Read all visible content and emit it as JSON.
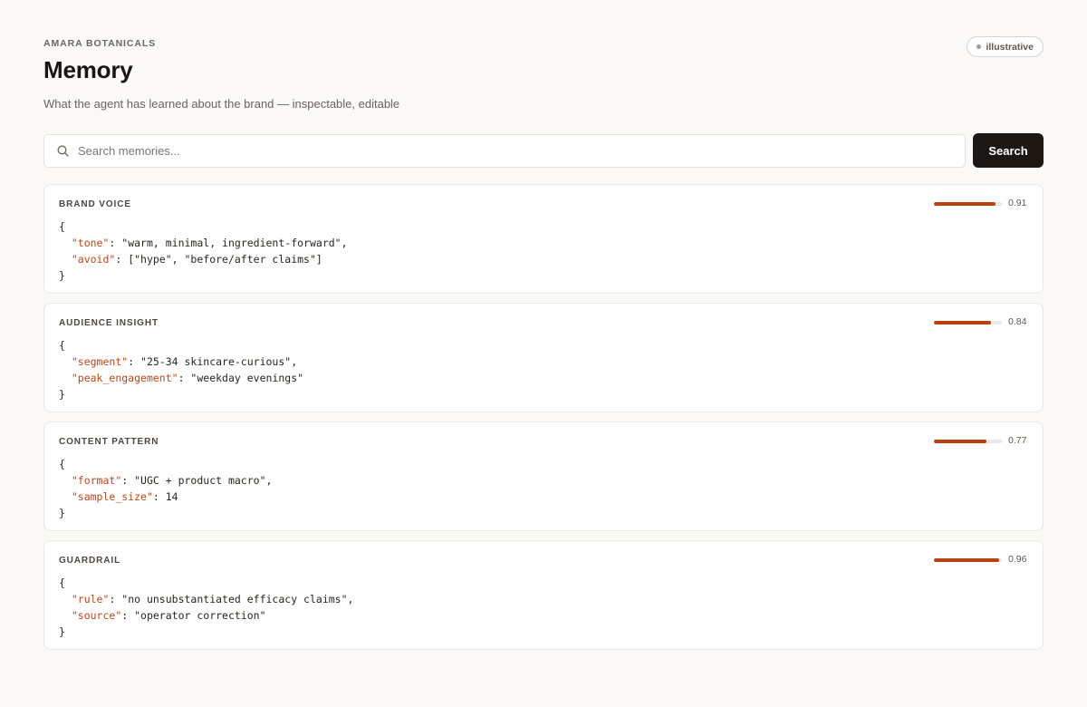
{
  "header": {
    "brand": "AMARA BOTANICALS",
    "title": "Memory",
    "subtitle": "What the agent has learned about the brand — inspectable, editable",
    "badge": "illustrative"
  },
  "search": {
    "placeholder": "Search memories...",
    "value": "",
    "button_label": "Search"
  },
  "colors": {
    "accent": "#b8420e",
    "button_bg": "#1d1713"
  },
  "memories": [
    {
      "label": "BRAND VOICE",
      "confidence": 0.91,
      "confidence_text": "0.91",
      "fields": [
        {
          "key": "\"tone\"",
          "value": "\"warm, minimal, ingredient-forward\","
        },
        {
          "key": "\"avoid\"",
          "value": "[\"hype\", \"before/after claims\"]"
        }
      ]
    },
    {
      "label": "AUDIENCE INSIGHT",
      "confidence": 0.84,
      "confidence_text": "0.84",
      "fields": [
        {
          "key": "\"segment\"",
          "value": "\"25-34 skincare-curious\","
        },
        {
          "key": "\"peak_engagement\"",
          "value": "\"weekday evenings\""
        }
      ]
    },
    {
      "label": "CONTENT PATTERN",
      "confidence": 0.77,
      "confidence_text": "0.77",
      "fields": [
        {
          "key": "\"format\"",
          "value": "\"UGC + product macro\","
        },
        {
          "key": "\"sample_size\"",
          "value": "14"
        }
      ]
    },
    {
      "label": "GUARDRAIL",
      "confidence": 0.96,
      "confidence_text": "0.96",
      "fields": [
        {
          "key": "\"rule\"",
          "value": "\"no unsubstantiated efficacy claims\","
        },
        {
          "key": "\"source\"",
          "value": "\"operator correction\""
        }
      ]
    }
  ]
}
